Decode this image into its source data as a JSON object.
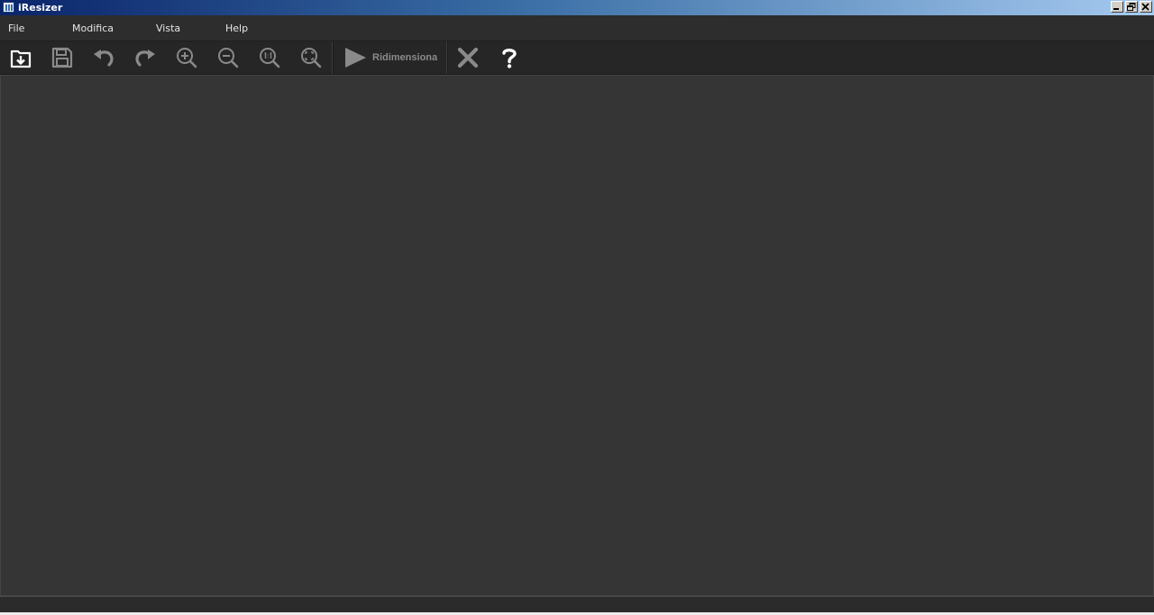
{
  "window": {
    "title": "iResizer"
  },
  "menu": {
    "items": [
      {
        "label": "File"
      },
      {
        "label": "Modifica"
      },
      {
        "label": "Vista"
      },
      {
        "label": "Help"
      }
    ]
  },
  "toolbar": {
    "icons": [
      "open-image-icon",
      "save-icon",
      "undo-icon",
      "redo-icon",
      "zoom-in-icon",
      "zoom-out-icon",
      "zoom-actual-size-icon",
      "zoom-fit-icon",
      "play-icon",
      "close-icon",
      "help-icon"
    ],
    "resize_label": "Ridimensiona"
  },
  "colors": {
    "menubar_bg": "#2d2d2d",
    "toolbar_bg": "#262626",
    "workspace_bg": "#353535",
    "icon_white": "#ffffff",
    "icon_gray": "#8a8a8a"
  }
}
